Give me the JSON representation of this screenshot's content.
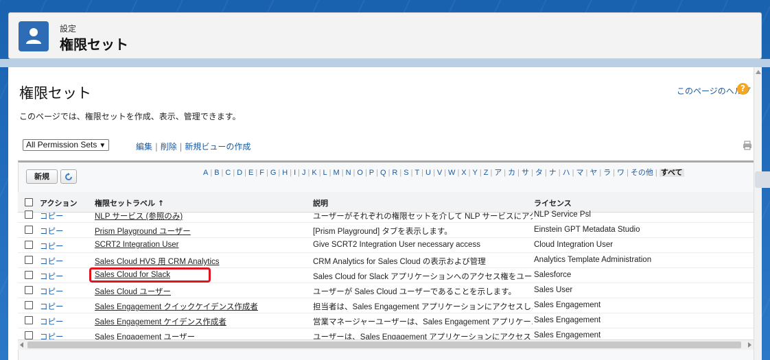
{
  "header": {
    "subtitle": "設定",
    "title": "権限セット"
  },
  "page": {
    "title": "権限セット",
    "help_link": "このページのヘルプ",
    "description": "このページでは、権限セットを作成、表示、管理できます。"
  },
  "view": {
    "selected": "All Permission Sets",
    "edit": "編集",
    "delete": "削除",
    "new_view": "新規ビューの作成"
  },
  "toolbar": {
    "new_button": "新規"
  },
  "alphabet": [
    "A",
    "B",
    "C",
    "D",
    "E",
    "F",
    "G",
    "H",
    "I",
    "J",
    "K",
    "L",
    "M",
    "N",
    "O",
    "P",
    "Q",
    "R",
    "S",
    "T",
    "U",
    "V",
    "W",
    "X",
    "Y",
    "Z",
    "ア",
    "カ",
    "サ",
    "タ",
    "ナ",
    "ハ",
    "マ",
    "ヤ",
    "ラ",
    "ワ",
    "その他",
    "すべて"
  ],
  "table": {
    "headers": {
      "action": "アクション",
      "label": "権限セットラベル ↑",
      "description": "説明",
      "license": "ライセンス"
    },
    "rows": [
      {
        "action": "コピー",
        "label": "NLP サービス (参照のみ)",
        "description": "ユーザーがそれぞれの権限セットを介して NLP サービスにアク…",
        "license": "NLP Service Psl"
      },
      {
        "action": "コピー",
        "label": "Prism Playground ユーザー",
        "description": "[Prism Playground] タブを表示します。",
        "license": "Einstein GPT Metadata Studio"
      },
      {
        "action": "コピー",
        "label": "SCRT2 Integration User",
        "description": "Give SCRT2 Integration User necessary access",
        "license": "Cloud Integration User"
      },
      {
        "action": "コピー",
        "label": "Sales Cloud HVS 用 CRM Analytics",
        "description": "CRM Analytics for Sales Cloud の表示および管理",
        "license": "Analytics Template Administration"
      },
      {
        "action": "コピー",
        "label": "Sales Cloud for Slack",
        "description": "Sales Cloud for Slack アプリケーションへのアクセス権をユー…",
        "license": "Salesforce"
      },
      {
        "action": "コピー",
        "label": "Sales Cloud ユーザー",
        "description": "ユーザーが Sales Cloud ユーザーであることを示します。",
        "license": "Sales User"
      },
      {
        "action": "コピー",
        "label": "Sales Engagement クイックケイデンス作成者",
        "description": "担当者は、Sales Engagement アプリケーションにアクセスし…",
        "license": "Sales Engagement"
      },
      {
        "action": "コピー",
        "label": "Sales Engagement ケイデンス作成者",
        "description": "営業マネージャーユーザーは、Sales Engagement アプリケー…",
        "license": "Sales Engagement"
      },
      {
        "action": "コピー",
        "label": "Sales Engagement ユーザー",
        "description": "ユーザーは、Sales Engagement アプリケーションにアクセスし…",
        "license": "Sales Engagement"
      }
    ]
  },
  "colors": {
    "link": "#1a5aa0",
    "highlight": "#e0141e",
    "header_icon": "#2e6db5",
    "help_icon": "#f5a623"
  }
}
